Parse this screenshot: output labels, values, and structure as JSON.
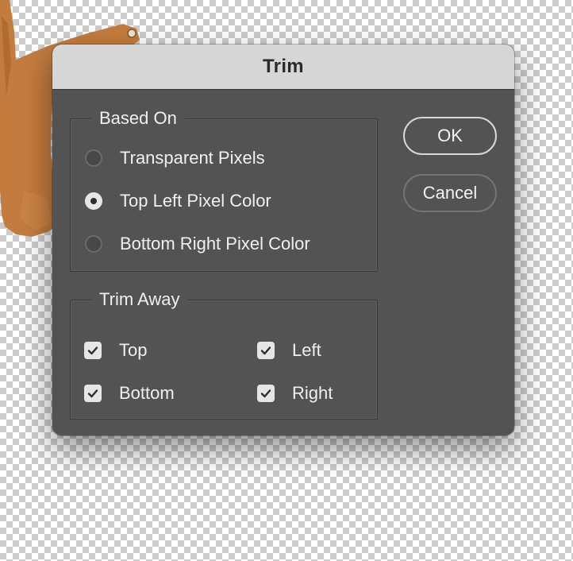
{
  "dialog": {
    "title": "Trim",
    "ok_label": "OK",
    "cancel_label": "Cancel"
  },
  "based_on": {
    "legend": "Based On",
    "options": [
      {
        "label": "Transparent Pixels",
        "selected": false
      },
      {
        "label": "Top Left Pixel Color",
        "selected": true
      },
      {
        "label": "Bottom Right Pixel Color",
        "selected": false
      }
    ]
  },
  "trim_away": {
    "legend": "Trim Away",
    "options": [
      {
        "label": "Top",
        "checked": true
      },
      {
        "label": "Left",
        "checked": true
      },
      {
        "label": "Bottom",
        "checked": true
      },
      {
        "label": "Right",
        "checked": true
      }
    ]
  },
  "colors": {
    "dialog_bg": "#535353",
    "titlebar_bg": "#d6d6d6",
    "text": "#f0f0f0"
  }
}
